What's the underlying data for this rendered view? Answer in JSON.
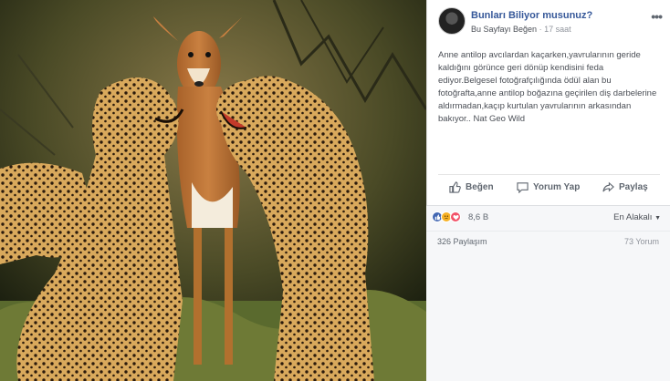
{
  "post": {
    "page_name": "Bunları Biliyor musunuz?",
    "like_page": "Bu Sayfayı Beğen",
    "separator": " · ",
    "time": "17 saat",
    "text": "Anne antilop avcılardan kaçarken,yavrularının geride kaldığını görünce geri dönüp kendisini feda ediyor.Belgesel fotoğrafçılığında ödül alan bu fotoğrafta,anne antilop boğazına geçirilen diş darbelerine aldırmadan,kaçıp kurtulan yavrularının arkasından bakıyor.. Nat Geo Wild"
  },
  "actions": {
    "like": "Beğen",
    "comment": "Yorum Yap",
    "share": "Paylaş"
  },
  "reactions": {
    "icons": [
      "like-icon",
      "sad-icon",
      "love-icon"
    ],
    "count": "8,6 B",
    "sort": "En Alakalı"
  },
  "stats": {
    "shares": "326 Paylaşım",
    "comments": "73 Yorum"
  },
  "colors": {
    "link_blue": "#365899",
    "like_blue": "#4267b2",
    "love_red": "#f25268",
    "sad_yellow": "#f7b125"
  }
}
